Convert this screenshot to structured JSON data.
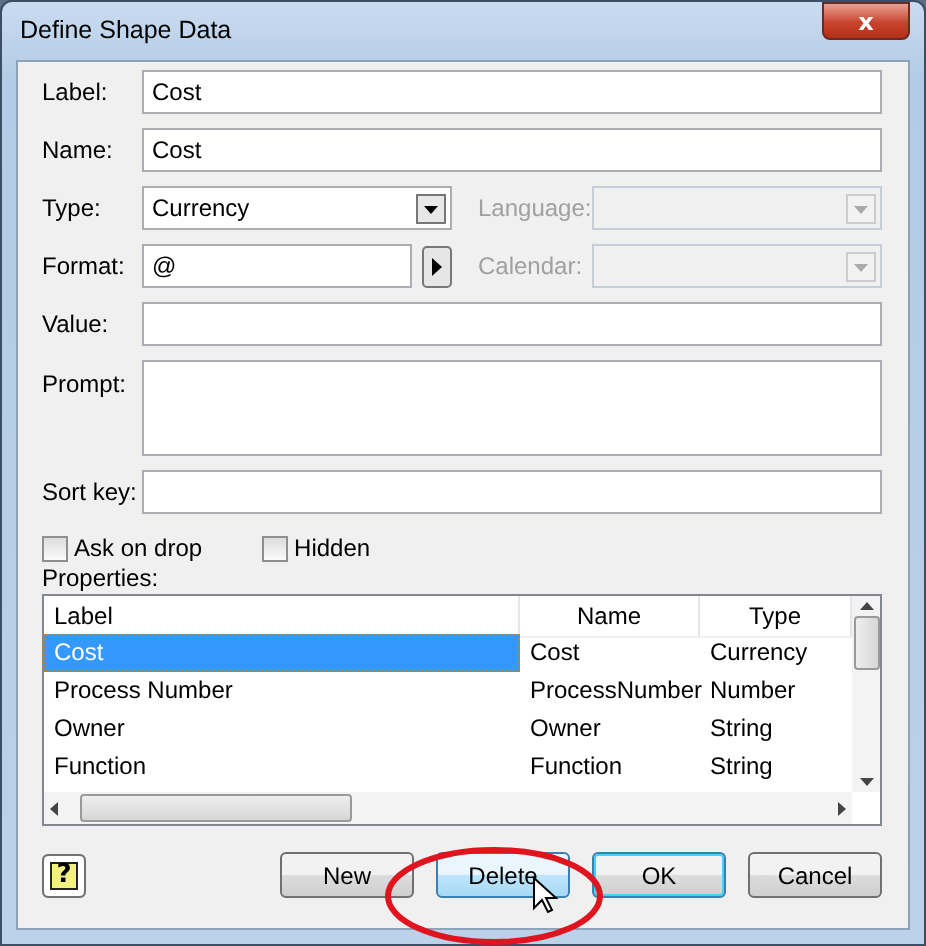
{
  "window": {
    "title": "Define Shape Data",
    "close_glyph": "x"
  },
  "label_field": {
    "label": "Label:",
    "value": "Cost"
  },
  "name_field": {
    "label": "Name:",
    "value": "Cost"
  },
  "type_field": {
    "label": "Type:",
    "value": "Currency"
  },
  "language_field": {
    "label": "Language:",
    "disabled": true
  },
  "format_field": {
    "label": "Format:",
    "value": "@"
  },
  "calendar_field": {
    "label": "Calendar:",
    "disabled": true
  },
  "value_field": {
    "label": "Value:"
  },
  "prompt_field": {
    "label": "Prompt:"
  },
  "sort_key_field": {
    "label": "Sort key:"
  },
  "checkboxes": [
    {
      "label": "Ask on drop",
      "checked": false
    },
    {
      "label": "Hidden",
      "checked": false
    }
  ],
  "properties": {
    "label": "Properties:",
    "columns": [
      "Label",
      "Name",
      "Type"
    ],
    "rows": [
      {
        "cells": [
          "Cost",
          "Cost",
          "Currency"
        ],
        "selected": true
      },
      {
        "cells": [
          "Process Number",
          "ProcessNumber",
          "Number"
        ],
        "selected": false
      },
      {
        "cells": [
          "Owner",
          "Owner",
          "String"
        ],
        "selected": false
      },
      {
        "cells": [
          "Function",
          "Function",
          "String"
        ],
        "selected": false
      }
    ]
  },
  "help_button": {
    "glyph": "?"
  },
  "buttons": [
    {
      "label": "New",
      "hovered": false,
      "default": false
    },
    {
      "label": "Delete",
      "hovered": true,
      "default": false
    },
    {
      "label": "OK",
      "hovered": false,
      "default": true
    },
    {
      "label": "Cancel",
      "hovered": false,
      "default": false
    }
  ]
}
